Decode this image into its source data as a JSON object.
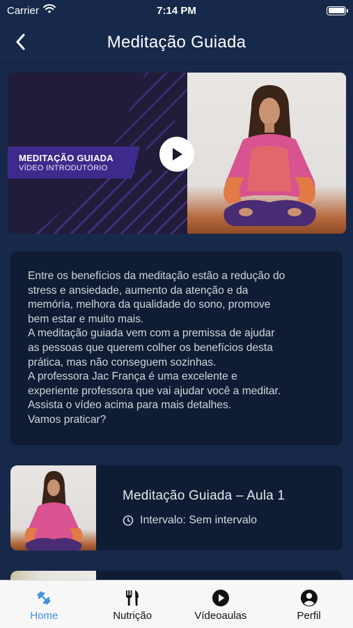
{
  "status_bar": {
    "carrier": "Carrier",
    "time": "7:14 PM"
  },
  "nav": {
    "title": "Meditação Guiada",
    "back_icon": "chevron-left-icon"
  },
  "video": {
    "banner_title": "MEDITAÇÃO GUIADA",
    "banner_subtitle": "VÍDEO INTRODUTÓRIO",
    "play_icon": "play-icon"
  },
  "description": {
    "lines": [
      "Entre os benefícios da meditação estão a redução do",
      "stress e ansiedade, aumento da atenção e da",
      "memória, melhora da qualidade do sono, promove",
      "bem estar e muito mais.",
      "A meditação guiada vem com a premissa de ajudar",
      "as pessoas que querem colher os benefícios desta",
      "prática, mas não conseguem sozinhas.",
      "A professora Jac França é uma excelente e",
      "experiente professora que vai ajudar você a meditar.",
      "Assista o vídeo acima para mais detalhes.",
      "Vamos praticar?"
    ]
  },
  "lessons": [
    {
      "title": "Meditação Guiada – Aula 1",
      "interval": "Intervalo: Sem intervalo",
      "icon": "clock-icon"
    }
  ],
  "tab_bar": {
    "tabs": [
      {
        "label": "Home",
        "icon": "dumbbell-icon",
        "active": true
      },
      {
        "label": "Nutrição",
        "icon": "fork-knife-icon",
        "active": false
      },
      {
        "label": "Vídeoaulas",
        "icon": "play-circle-icon",
        "active": false
      },
      {
        "label": "Perfil",
        "icon": "user-circle-icon",
        "active": false
      }
    ]
  },
  "colors": {
    "background": "#17294a",
    "card": "#0f1c33",
    "accent": "#3f8fe0",
    "banner": "#3e2a8a",
    "tab_bar": "#f7f7f7"
  }
}
